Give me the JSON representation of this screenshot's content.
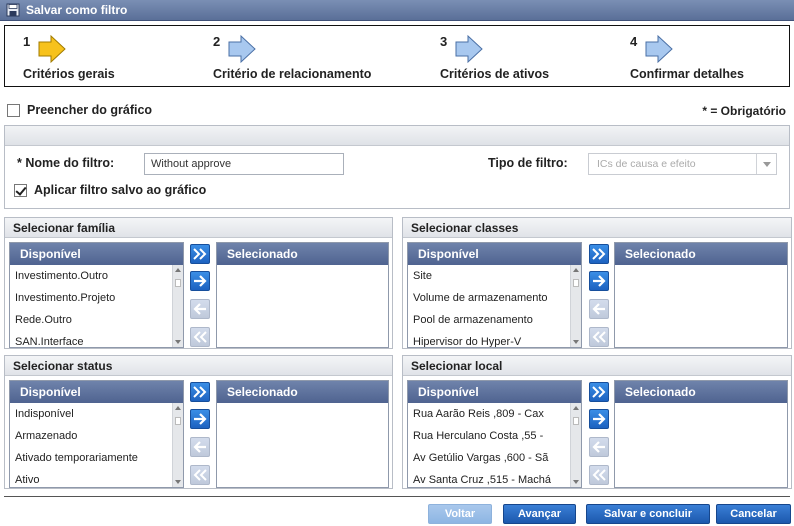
{
  "window": {
    "title": "Salvar como filtro"
  },
  "wizard": {
    "steps": [
      {
        "number": "1",
        "label": "Critérios gerais",
        "active": true
      },
      {
        "number": "2",
        "label": "Critério de relacionamento",
        "active": false
      },
      {
        "number": "3",
        "label": "Critérios de ativos",
        "active": false
      },
      {
        "number": "4",
        "label": "Confirmar detalhes",
        "active": false
      }
    ]
  },
  "fill_from_chart": {
    "label": "Preencher do gráfico",
    "checked": false
  },
  "required_note": "* = Obrigatório",
  "filter": {
    "name_label": "* Nome do filtro:",
    "name_value": "Without approve",
    "type_label": "Tipo de filtro:",
    "type_value": "ICs de causa e efeito",
    "apply_label": "Aplicar filtro salvo ao gráfico",
    "apply_checked": true
  },
  "panels": {
    "family": {
      "title": "Selecionar família",
      "available_header": "Disponível",
      "selected_header": "Selecionado",
      "available": [
        "Investimento.Outro",
        "Investimento.Projeto",
        "Rede.Outro",
        "SAN.Interface"
      ]
    },
    "classes": {
      "title": "Selecionar classes",
      "available_header": "Disponível",
      "selected_header": "Selecionado",
      "available": [
        "Site",
        "Volume de armazenamento",
        "Pool de armazenamento",
        "Hipervisor do Hyper-V"
      ]
    },
    "status": {
      "title": "Selecionar status",
      "available_header": "Disponível",
      "selected_header": "Selecionado",
      "available": [
        "Indisponível",
        "Armazenado",
        "Ativado temporariamente",
        "Ativo"
      ]
    },
    "location": {
      "title": "Selecionar local",
      "available_header": "Disponível",
      "selected_header": "Selecionado",
      "available": [
        "Rua Aarão Reis ,809 - Cax",
        "Rua Herculano Costa ,55 -",
        "Av Getúlio Vargas ,600 - Sã",
        "Av Santa Cruz ,515 - Machá"
      ]
    }
  },
  "buttons": {
    "back": "Voltar",
    "next": "Avançar",
    "save_finish": "Salvar e concluir",
    "cancel": "Cancelar"
  },
  "colors": {
    "title_bar": "#5a6f98",
    "list_header": "#4f6390",
    "button_primary": "#1c58ad",
    "active_step": "#f7c21c",
    "step_arrow": "#a8c8ef"
  }
}
